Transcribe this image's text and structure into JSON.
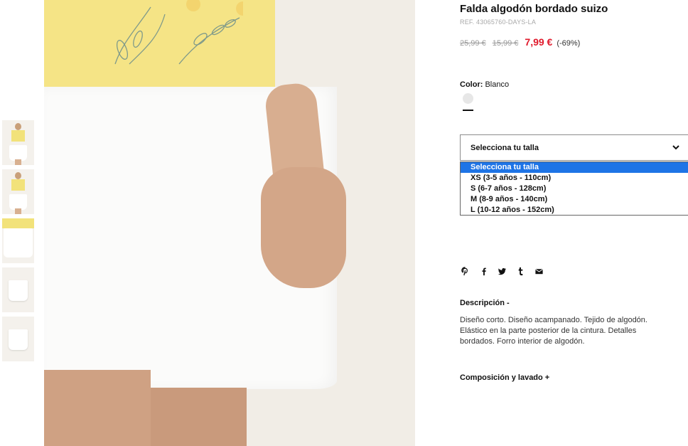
{
  "product": {
    "title": "Falda algodón bordado suizo",
    "ref": "REF. 43065760-DAYS-LA",
    "prices": {
      "original": "25,99 €",
      "previous": "15,99 €",
      "current": "7,99 €",
      "discount": "(-69%)"
    }
  },
  "color": {
    "label": "Color:",
    "value": "Blanco",
    "swatch_hex": "#e7e7e7"
  },
  "size_select": {
    "label": "Selecciona tu talla",
    "options": [
      "Selecciona tu talla",
      "XS (3-5 años - 110cm)",
      "S (6-7 años - 128cm)",
      "M (8-9 años - 140cm)",
      "L (10-12 años - 152cm)"
    ],
    "selected_index": 0
  },
  "share_icons": [
    "pinterest-icon",
    "facebook-icon",
    "twitter-icon",
    "tumblr-icon",
    "email-icon"
  ],
  "description": {
    "heading": "Descripción -",
    "text": "Diseño corto. Diseño acampanado. Tejido de algodón. Elástico en la parte posterior de la cintura. Detalles bordados. Forro interior de algodón."
  },
  "composition": {
    "heading": "Composición y lavado +"
  },
  "colors": {
    "accent_price": "#e0192b",
    "selected_option": "#1e74e6",
    "border": "#8c8c8c"
  }
}
